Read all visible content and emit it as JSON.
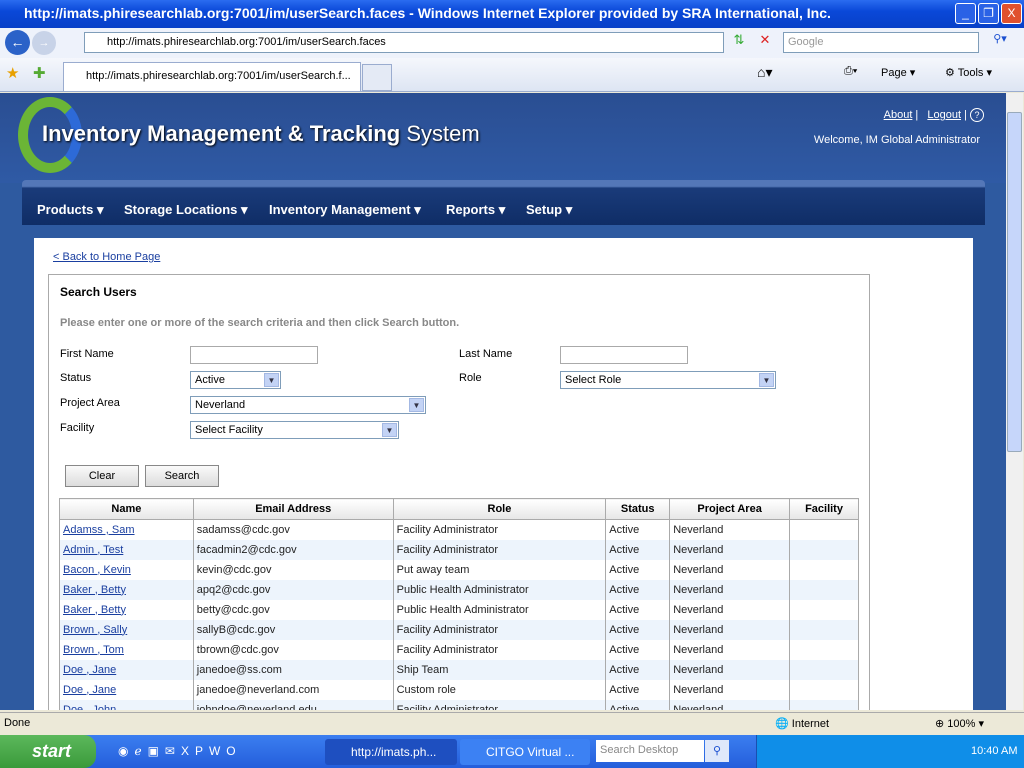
{
  "window": {
    "title": "http://imats.phiresearchlab.org:7001/im/userSearch.faces - Windows Internet Explorer provided by SRA International, Inc.",
    "minimize": "_",
    "restore": "❐",
    "close": "X"
  },
  "browser": {
    "address": "http://imats.phiresearchlab.org:7001/im/userSearch.faces",
    "search_placeholder": "Google",
    "tab_label": "http://imats.phiresearchlab.org:7001/im/userSearch.f...",
    "page_menu": "Page",
    "tools_menu": "Tools",
    "status": "Done",
    "zone": "Internet",
    "zoom": "100%"
  },
  "app": {
    "title_bold": "Inventory Management & Tracking",
    "title_light": "System",
    "about": "About",
    "logout": "Logout",
    "help": "?",
    "welcome": "Welcome, IM Global Administrator"
  },
  "menu": [
    "Products",
    "Storage Locations",
    "Inventory Management",
    "Reports",
    "Setup"
  ],
  "content": {
    "back_link": "< Back to Home Page",
    "box_title": "Search Users",
    "hint": "Please enter one or more of the search criteria and then click Search button.",
    "first_name_label": "First Name",
    "last_name_label": "Last Name",
    "status_label": "Status",
    "status_value": "Active",
    "role_label": "Role",
    "role_value": "Select Role",
    "project_label": "Project Area",
    "project_value": "Neverland",
    "facility_label": "Facility",
    "facility_value": "Select Facility",
    "clear": "Clear",
    "search": "Search"
  },
  "table": {
    "headers": [
      "Name",
      "Email Address",
      "Role",
      "Status",
      "Project Area",
      "Facility"
    ],
    "rows": [
      [
        "Adamss , Sam",
        "sadamss@cdc.gov",
        "Facility Administrator",
        "Active",
        "Neverland",
        ""
      ],
      [
        "Admin , Test",
        "facadmin2@cdc.gov",
        "Facility Administrator",
        "Active",
        "Neverland",
        ""
      ],
      [
        "Bacon , Kevin",
        "kevin@cdc.gov",
        "Put away team",
        "Active",
        "Neverland",
        ""
      ],
      [
        "Baker , Betty",
        "apq2@cdc.gov",
        "Public Health Administrator",
        "Active",
        "Neverland",
        ""
      ],
      [
        "Baker , Betty",
        "betty@cdc.gov",
        "Public Health Administrator",
        "Active",
        "Neverland",
        ""
      ],
      [
        "Brown , Sally",
        "sallyB@cdc.gov",
        "Facility Administrator",
        "Active",
        "Neverland",
        ""
      ],
      [
        "Brown , Tom",
        "tbrown@cdc.gov",
        "Facility Administrator",
        "Active",
        "Neverland",
        ""
      ],
      [
        "Doe , Jane",
        "janedoe@ss.com",
        "Ship Team",
        "Active",
        "Neverland",
        ""
      ],
      [
        "Doe , Jane",
        "janedoe@neverland.com",
        "Custom role",
        "Active",
        "Neverland",
        ""
      ],
      [
        "Doe , John",
        "johndoe@neverland.edu",
        "Facility Administrator",
        "Active",
        "Neverland",
        ""
      ]
    ]
  },
  "taskbar": {
    "start": "start",
    "task1": "http://imats.ph...",
    "task2": "CITGO Virtual ...",
    "search_desktop": "Search Desktop",
    "clock": "10:40 AM"
  }
}
